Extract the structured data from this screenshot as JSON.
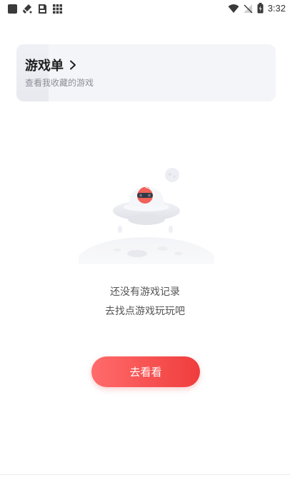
{
  "status_bar": {
    "time": "3:32",
    "left_icons": [
      "square-icon",
      "broom-icon",
      "sd-card-icon",
      "grid-icon"
    ],
    "right_icons": [
      "wifi-icon",
      "no-signal-icon",
      "battery-icon"
    ]
  },
  "collection_card": {
    "title": "游戏单",
    "subtitle": "查看我收藏的游戏",
    "chevron": "chevron-right-icon"
  },
  "empty_state": {
    "illustration": "ufo-illustration",
    "line1": "还没有游戏记录",
    "line2": "去找点游戏玩玩吧"
  },
  "cta": {
    "label": "去看看",
    "colors": [
      "#ff6b6b",
      "#f03d3d"
    ]
  }
}
